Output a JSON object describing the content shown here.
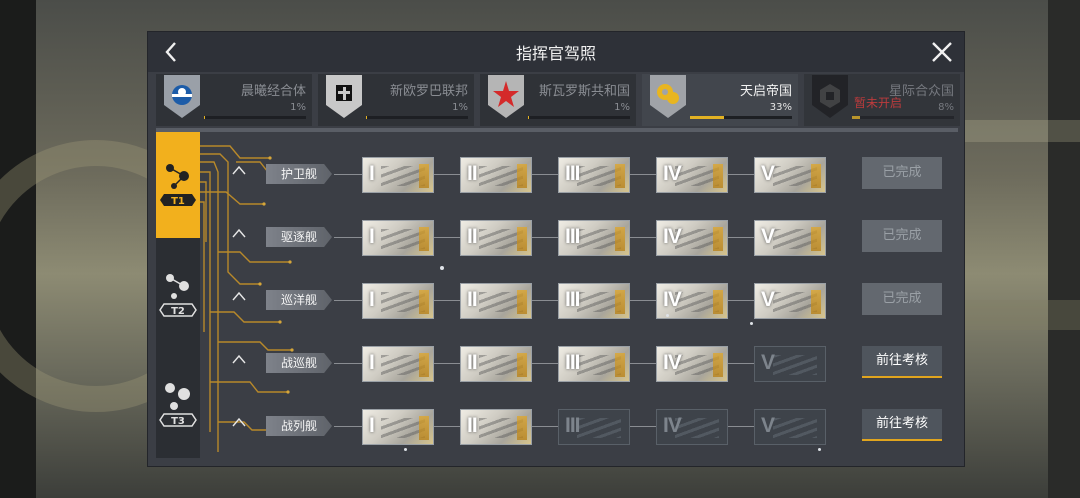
{
  "title": "指挥官驾照",
  "factions": [
    {
      "name": "晨曦经合体",
      "percent": "1%",
      "progress": 0.01,
      "active": false,
      "status": ""
    },
    {
      "name": "新欧罗巴联邦",
      "percent": "1%",
      "progress": 0.01,
      "active": false,
      "status": ""
    },
    {
      "name": "斯瓦罗斯共和国",
      "percent": "1%",
      "progress": 0.01,
      "active": false,
      "status": ""
    },
    {
      "name": "天启帝国",
      "percent": "33%",
      "progress": 0.33,
      "active": true,
      "status": ""
    },
    {
      "name": "星际合众国",
      "percent": "8%",
      "progress": 0.08,
      "active": false,
      "status": "暂未开启"
    }
  ],
  "tiers": [
    {
      "label": "T1",
      "active": true
    },
    {
      "label": "T2",
      "active": false
    },
    {
      "label": "T3",
      "active": false
    }
  ],
  "rows": [
    {
      "label": "护卫舰",
      "levels": [
        "I",
        "II",
        "III",
        "IV",
        "V"
      ],
      "unlocked": [
        true,
        true,
        true,
        true,
        true
      ],
      "button": "已完成",
      "button_active": false
    },
    {
      "label": "驱逐舰",
      "levels": [
        "I",
        "II",
        "III",
        "IV",
        "V"
      ],
      "unlocked": [
        true,
        true,
        true,
        true,
        true
      ],
      "button": "已完成",
      "button_active": false
    },
    {
      "label": "巡洋舰",
      "levels": [
        "I",
        "II",
        "III",
        "IV",
        "V"
      ],
      "unlocked": [
        true,
        true,
        true,
        true,
        true
      ],
      "button": "已完成",
      "button_active": false
    },
    {
      "label": "战巡舰",
      "levels": [
        "I",
        "II",
        "III",
        "IV",
        "V"
      ],
      "unlocked": [
        true,
        true,
        true,
        true,
        false
      ],
      "button": "前往考核",
      "button_active": true
    },
    {
      "label": "战列舰",
      "levels": [
        "I",
        "II",
        "III",
        "IV",
        "V"
      ],
      "unlocked": [
        true,
        true,
        false,
        false,
        false
      ],
      "button": "前往考核",
      "button_active": true
    }
  ],
  "colors": {
    "accent": "#f2b01d",
    "panel": "#3b3e45",
    "locked_text": "#e63a3a"
  }
}
